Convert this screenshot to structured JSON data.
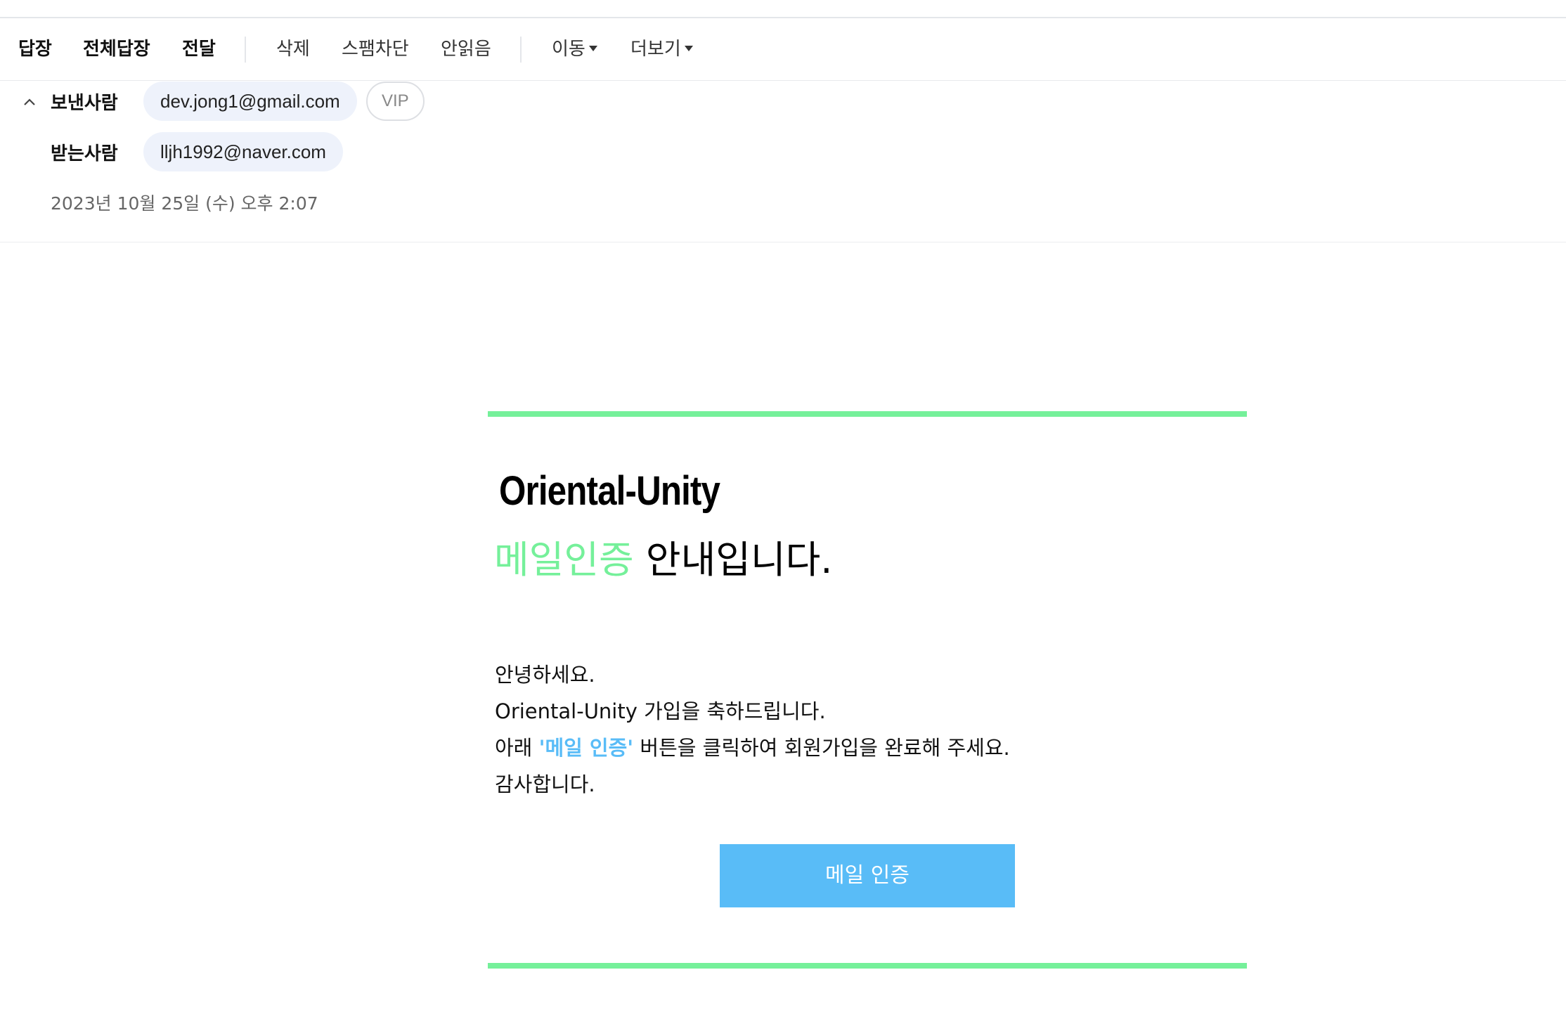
{
  "toolbar": {
    "reply": "답장",
    "reply_all": "전체답장",
    "forward": "전달",
    "delete": "삭제",
    "spam_block": "스팸차단",
    "mark_unread": "안읽음",
    "move": "이동",
    "more": "더보기"
  },
  "header": {
    "sender_label": "보낸사람",
    "sender_email": "dev.jong1@gmail.com",
    "vip_label": "VIP",
    "recipient_label": "받는사람",
    "recipient_email": "lljh1992@naver.com",
    "date": "2023년 10월 25일 (수) 오후 2:07"
  },
  "message": {
    "brand": "Oriental-Unity",
    "headline_accent": "메일인증",
    "headline_rest": "안내입니다.",
    "greeting": "안녕하세요.",
    "congrats": "Oriental-Unity 가입을 축하드립니다.",
    "instruction_prefix": "아래",
    "instruction_highlight": "'메일 인증'",
    "instruction_suffix": "버튼을 클릭하여 회원가입을 완료해 주세요.",
    "thanks": "감사합니다.",
    "verify_button": "메일 인증"
  },
  "colors": {
    "accent_green": "#75f09a",
    "accent_blue": "#59bcf7",
    "chip_bg": "#eef2fb"
  }
}
